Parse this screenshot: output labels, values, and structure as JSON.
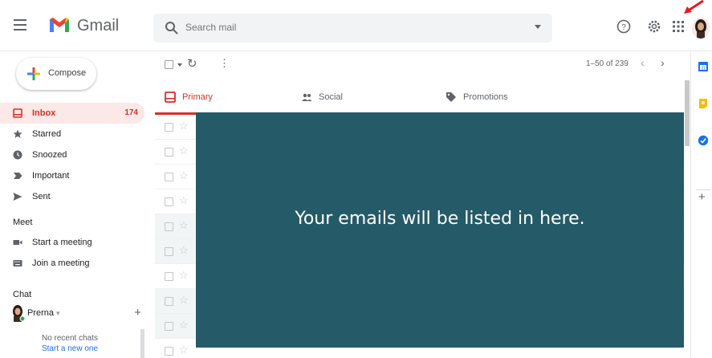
{
  "app": {
    "name": "Gmail",
    "accent": "#d93025"
  },
  "search": {
    "placeholder": "Search mail"
  },
  "header_icons": [
    "menu-icon",
    "help-icon",
    "gear-icon",
    "apps-icon",
    "avatar"
  ],
  "sidebar": {
    "compose_label": "Compose",
    "items": [
      {
        "label": "Inbox",
        "count": "174",
        "icon": "inbox-icon"
      },
      {
        "label": "Starred",
        "icon": "star-icon"
      },
      {
        "label": "Snoozed",
        "icon": "clock-icon"
      },
      {
        "label": "Important",
        "icon": "important-icon"
      },
      {
        "label": "Sent",
        "icon": "send-icon"
      }
    ],
    "meet": {
      "title": "Meet",
      "items": [
        {
          "label": "Start a meeting",
          "icon": "video-icon"
        },
        {
          "label": "Join a meeting",
          "icon": "keyboard-icon"
        }
      ]
    },
    "chat": {
      "title": "Chat",
      "user": "Prerna",
      "caret": "▾",
      "add": "+",
      "no_chats": "No recent chats",
      "start_new": "Start a new one"
    }
  },
  "toolbar": {
    "pager": "1–50 of 239",
    "prev": "‹",
    "next": "›"
  },
  "tabs": [
    {
      "label": "Primary",
      "icon": "inbox-icon",
      "active": true
    },
    {
      "label": "Social",
      "icon": "people-icon",
      "active": false
    },
    {
      "label": "Promotions",
      "icon": "tag-icon",
      "active": false
    }
  ],
  "rows": {
    "count": 10
  },
  "overlay": {
    "message": "Your emails will be listed in here.",
    "color": "#255a68"
  },
  "side_panel": [
    "calendar-icon",
    "keep-icon",
    "tasks-icon",
    "add-icon"
  ]
}
